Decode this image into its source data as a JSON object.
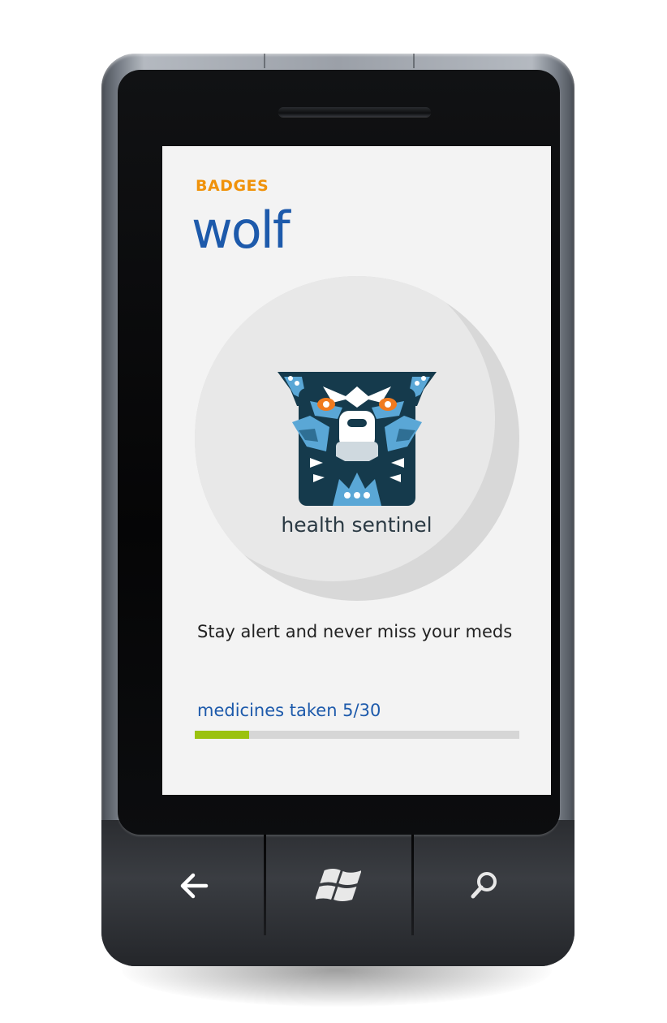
{
  "screen": {
    "header_label": "BADGES",
    "title": "wolf",
    "badge": {
      "name": "health sentinel",
      "icon": "wolf-totem-icon"
    },
    "description": "Stay alert and never miss your meds",
    "progress": {
      "label": "medicines taken 5/30",
      "current": 5,
      "total": 30
    }
  },
  "hardware_buttons": [
    {
      "name": "back",
      "icon": "back-arrow-icon"
    },
    {
      "name": "start",
      "icon": "windows-logo-icon"
    },
    {
      "name": "search",
      "icon": "search-icon"
    }
  ],
  "colors": {
    "accent_orange": "#f0920a",
    "accent_blue": "#1d5aab",
    "progress_green": "#9bc20e",
    "progress_track": "#d6d6d6",
    "screen_background": "#f3f3f3",
    "wolf_dark": "#153a4c",
    "wolf_light": "#5aa7d6",
    "wolf_eye": "#f07a1e"
  }
}
